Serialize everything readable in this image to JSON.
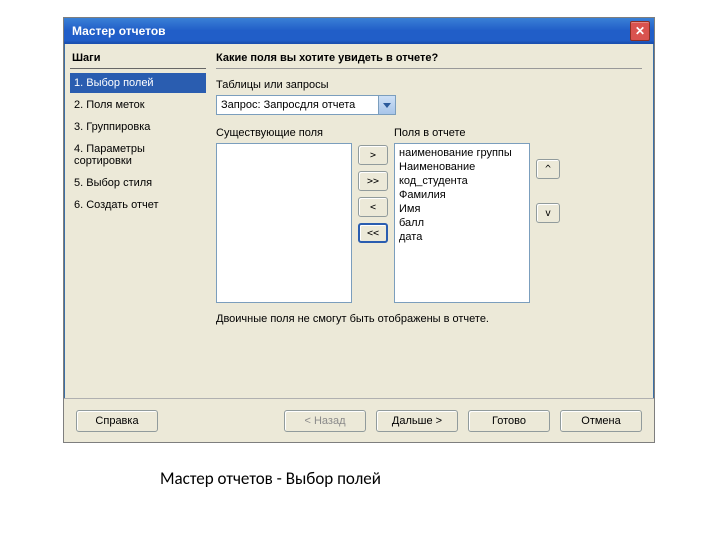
{
  "window": {
    "title": "Мастер отчетов"
  },
  "sidebar": {
    "header": "Шаги",
    "steps": [
      {
        "label": "1. Выбор полей",
        "active": true
      },
      {
        "label": "2. Поля меток",
        "active": false
      },
      {
        "label": "3. Группировка",
        "active": false
      },
      {
        "label": "4. Параметры сортировки",
        "active": false
      },
      {
        "label": "5. Выбор стиля",
        "active": false
      },
      {
        "label": "6. Создать отчет",
        "active": false
      }
    ]
  },
  "main": {
    "heading": "Какие поля вы хотите увидеть в отчете?",
    "tables_label": "Таблицы или запросы",
    "combo_value": "Запрос: Запросдля отчета",
    "available_label": "Существующие поля",
    "selected_label": "Поля в отчете",
    "available_fields": [],
    "selected_fields": [
      "наименование группы",
      "Наименование",
      "код_студента",
      "Фамилия",
      "Имя",
      "балл",
      "дата"
    ],
    "move_buttons": {
      "add": ">",
      "add_all": ">>",
      "remove": "<",
      "remove_all": "<<"
    },
    "order_buttons": {
      "up": "^",
      "down": "v"
    },
    "note": "Двоичные поля не смогут быть отображены в отчете."
  },
  "footer": {
    "help": "Справка",
    "back": "< Назад",
    "next": "Дальше >",
    "finish": "Готово",
    "cancel": "Отмена"
  },
  "caption": "Мастер отчетов - Выбор полей"
}
